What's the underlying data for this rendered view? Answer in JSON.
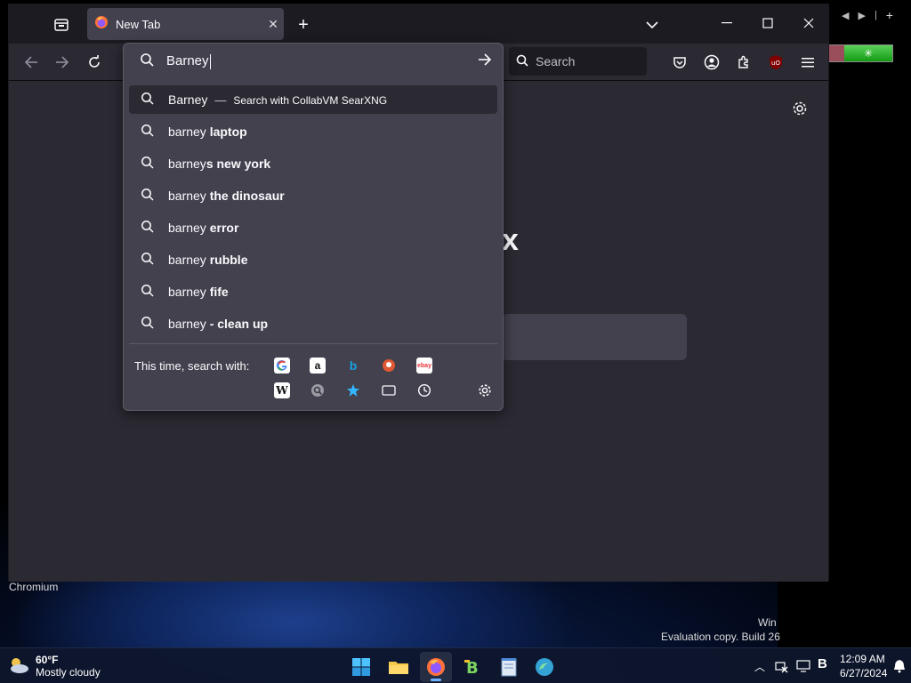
{
  "browser": {
    "tab_title": "New Tab",
    "url_text": "Barney",
    "search_placeholder": "Search",
    "brand_text": "x"
  },
  "suggestions": [
    {
      "prefix": "Barney",
      "bold": "",
      "dash": "—",
      "action": "Search with CollabVM SearXNG",
      "selected": true
    },
    {
      "prefix": "barney ",
      "bold": "laptop"
    },
    {
      "prefix": "barney",
      "bold": "s new york"
    },
    {
      "prefix": "barney ",
      "bold": "the dinosaur"
    },
    {
      "prefix": "barney ",
      "bold": "error"
    },
    {
      "prefix": "barney ",
      "bold": "rubble"
    },
    {
      "prefix": "barney ",
      "bold": "fife"
    },
    {
      "prefix": "barney ",
      "bold": "- clean up"
    }
  ],
  "oneoff": {
    "label": "This time, search with:",
    "engines": [
      "google-icon",
      "amazon-icon",
      "bing-icon",
      "duckduckgo-icon",
      "ebay-icon",
      "wikipedia-icon",
      "searxng-icon",
      "bookmarks-icon",
      "tabs-icon",
      "history-icon",
      "search-settings-icon"
    ]
  },
  "desktop": {
    "chromium_label": "Chromium",
    "watermark_line1": "Win",
    "watermark_line2": "Evaluation copy. Build 26"
  },
  "taskbar": {
    "weather_temp": "60°F",
    "weather_desc": "Mostly cloudy",
    "time": "12:09 AM",
    "date": "6/27/2024"
  },
  "colors": {
    "panel_bg": "#42414d",
    "chrome_bg": "#2b2a33",
    "tabbar_bg": "#1c1b22",
    "accent": "#6fb1ff"
  }
}
